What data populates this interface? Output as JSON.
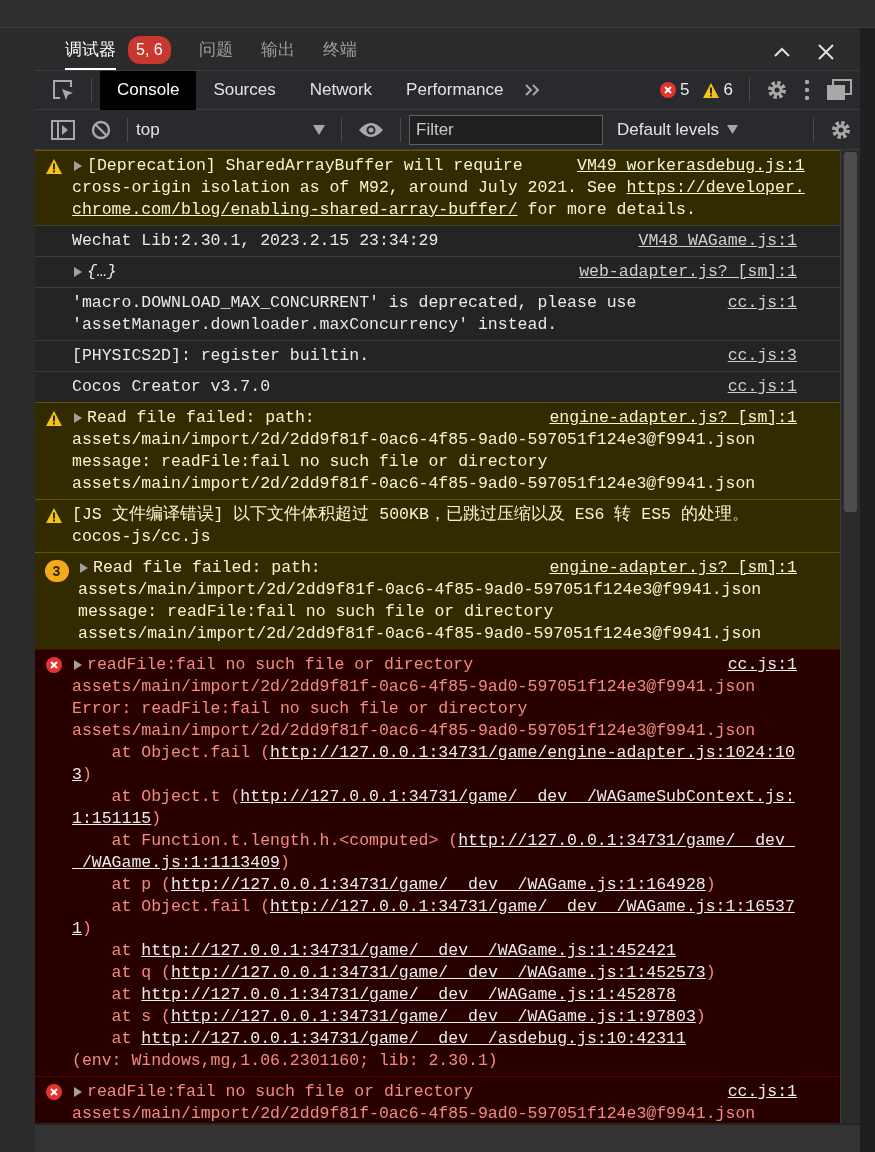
{
  "top_tabs": [
    {
      "label": "调试器",
      "selected": true,
      "badge": "5, 6"
    },
    {
      "label": "问题",
      "selected": false
    },
    {
      "label": "输出",
      "selected": false
    },
    {
      "label": "终端",
      "selected": false
    }
  ],
  "devtools_tabs": [
    {
      "label": "Console",
      "selected": true
    },
    {
      "label": "Sources",
      "selected": false
    },
    {
      "label": "Network",
      "selected": false
    },
    {
      "label": "Performance",
      "selected": false
    }
  ],
  "counts": {
    "errors": "5",
    "warnings": "6"
  },
  "context": {
    "value": "top"
  },
  "filter": {
    "placeholder": "Filter"
  },
  "levels": {
    "label": "Default levels"
  },
  "messages": [
    {
      "kind": "warning",
      "expandable": true,
      "source": "VM49 workerasdebug.js:1",
      "lines": [
        [
          {
            "kind": "text",
            "text": "[Deprecation] SharedArrayBuffer will require"
          }
        ],
        [
          {
            "kind": "text",
            "text": "cross-origin isolation as of M92, around July 2021. See "
          },
          {
            "kind": "link",
            "text": "https://developer."
          }
        ],
        [
          {
            "kind": "link",
            "text": "chrome.com/blog/enabling-shared-array-buffer/"
          },
          {
            "kind": "text",
            "text": " for more details."
          }
        ]
      ]
    },
    {
      "kind": "info",
      "expandable": false,
      "source": "VM48 WAGame.js:1",
      "lines": [
        [
          {
            "kind": "text",
            "text": "Wechat Lib:2.30.1, 2023.2.15 23:34:29"
          }
        ]
      ]
    },
    {
      "kind": "info",
      "expandable": true,
      "source": "web-adapter.js? [sm]:1",
      "lines": [
        [
          {
            "kind": "object",
            "text": "{…}"
          }
        ]
      ]
    },
    {
      "kind": "info",
      "expandable": false,
      "source": "cc.js:1",
      "lines": [
        [
          {
            "kind": "text",
            "text": "'macro.DOWNLOAD_MAX_CONCURRENT' is deprecated, please use"
          }
        ],
        [
          {
            "kind": "text",
            "text": "'assetManager.downloader.maxConcurrency' instead."
          }
        ]
      ]
    },
    {
      "kind": "info",
      "expandable": false,
      "source": "cc.js:3",
      "lines": [
        [
          {
            "kind": "text",
            "text": "[PHYSICS2D]: register builtin."
          }
        ]
      ]
    },
    {
      "kind": "info",
      "expandable": false,
      "source": "cc.js:1",
      "lines": [
        [
          {
            "kind": "text",
            "text": "Cocos Creator v3.7.0"
          }
        ]
      ]
    },
    {
      "kind": "warning",
      "expandable": true,
      "source": "engine-adapter.js? [sm]:1",
      "lines": [
        [
          {
            "kind": "text",
            "text": "Read file failed: path:"
          }
        ],
        [
          {
            "kind": "text",
            "text": "assets/main/import/2d/2dd9f81f-0ac6-4f85-9ad0-597051f124e3@f9941.json"
          }
        ],
        [
          {
            "kind": "text",
            "text": "message: readFile:fail no such file or directory"
          }
        ],
        [
          {
            "kind": "text",
            "text": "assets/main/import/2d/2dd9f81f-0ac6-4f85-9ad0-597051f124e3@f9941.json"
          }
        ]
      ]
    },
    {
      "kind": "warning",
      "expandable": false,
      "lines": [
        [
          {
            "kind": "text",
            "text": "[JS 文件编译错误] 以下文件体积超过 500KB，已跳过压缩以及 ES6 转 ES5 的处理。"
          }
        ],
        [
          {
            "kind": "text",
            "text": "cocos-js/cc.js"
          }
        ]
      ]
    },
    {
      "kind": "warning",
      "expandable": true,
      "repeat_count": "3",
      "source": "engine-adapter.js? [sm]:1",
      "lines": [
        [
          {
            "kind": "text",
            "text": "Read file failed: path:"
          }
        ],
        [
          {
            "kind": "text",
            "text": "assets/main/import/2d/2dd9f81f-0ac6-4f85-9ad0-597051f124e3@f9941.json"
          }
        ],
        [
          {
            "kind": "text",
            "text": "message: readFile:fail no such file or directory"
          }
        ],
        [
          {
            "kind": "text",
            "text": "assets/main/import/2d/2dd9f81f-0ac6-4f85-9ad0-597051f124e3@f9941.json"
          }
        ]
      ]
    },
    {
      "kind": "error",
      "expandable": true,
      "source": "cc.js:1",
      "lines": [
        [
          {
            "kind": "text",
            "text": "readFile:fail no such file or directory"
          }
        ],
        [
          {
            "kind": "text",
            "text": "assets/main/import/2d/2dd9f81f-0ac6-4f85-9ad0-597051f124e3@f9941.json"
          }
        ],
        [
          {
            "kind": "text",
            "text": "Error: readFile:fail no such file or directory"
          }
        ],
        [
          {
            "kind": "text",
            "text": "assets/main/import/2d/2dd9f81f-0ac6-4f85-9ad0-597051f124e3@f9941.json"
          }
        ],
        [
          {
            "kind": "text",
            "text": "    at Object.fail ("
          },
          {
            "kind": "link",
            "text": "http://127.0.0.1:34731/game/engine-adapter.js:1024:10"
          }
        ],
        [
          {
            "kind": "link",
            "text": "3"
          },
          {
            "kind": "text",
            "text": ")"
          }
        ],
        [
          {
            "kind": "text",
            "text": "    at Object.t ("
          },
          {
            "kind": "link",
            "text": "http://127.0.0.1:34731/game/__dev__/WAGameSubContext.js:"
          }
        ],
        [
          {
            "kind": "link",
            "text": "1:151115"
          },
          {
            "kind": "text",
            "text": ")"
          }
        ],
        [
          {
            "kind": "text",
            "text": "    at Function.t.length.h.<computed> ("
          },
          {
            "kind": "link",
            "text": "http://127.0.0.1:34731/game/__dev_"
          }
        ],
        [
          {
            "kind": "link",
            "text": "_/WAGame.js:1:1113409"
          },
          {
            "kind": "text",
            "text": ")"
          }
        ],
        [
          {
            "kind": "text",
            "text": "    at p ("
          },
          {
            "kind": "link",
            "text": "http://127.0.0.1:34731/game/__dev__/WAGame.js:1:164928"
          },
          {
            "kind": "text",
            "text": ")"
          }
        ],
        [
          {
            "kind": "text",
            "text": "    at Object.fail ("
          },
          {
            "kind": "link",
            "text": "http://127.0.0.1:34731/game/__dev__/WAGame.js:1:16537"
          }
        ],
        [
          {
            "kind": "link",
            "text": "1"
          },
          {
            "kind": "text",
            "text": ")"
          }
        ],
        [
          {
            "kind": "text",
            "text": "    at "
          },
          {
            "kind": "link",
            "text": "http://127.0.0.1:34731/game/__dev__/WAGame.js:1:452421"
          }
        ],
        [
          {
            "kind": "text",
            "text": "    at q ("
          },
          {
            "kind": "link",
            "text": "http://127.0.0.1:34731/game/__dev__/WAGame.js:1:452573"
          },
          {
            "kind": "text",
            "text": ")"
          }
        ],
        [
          {
            "kind": "text",
            "text": "    at "
          },
          {
            "kind": "link",
            "text": "http://127.0.0.1:34731/game/__dev__/WAGame.js:1:452878"
          }
        ],
        [
          {
            "kind": "text",
            "text": "    at s ("
          },
          {
            "kind": "link",
            "text": "http://127.0.0.1:34731/game/__dev__/WAGame.js:1:97803"
          },
          {
            "kind": "text",
            "text": ")"
          }
        ],
        [
          {
            "kind": "text",
            "text": "    at "
          },
          {
            "kind": "link",
            "text": "http://127.0.0.1:34731/game/__dev__/asdebug.js:10:42311"
          }
        ],
        [
          {
            "kind": "text",
            "text": "(env: Windows,mg,1.06.2301160; lib: 2.30.1)"
          }
        ]
      ]
    },
    {
      "kind": "error",
      "expandable": true,
      "source": "cc.js:1",
      "lines": [
        [
          {
            "kind": "text",
            "text": "readFile:fail no such file or directory"
          }
        ],
        [
          {
            "kind": "text",
            "text": "assets/main/import/2d/2dd9f81f-0ac6-4f85-9ad0-597051f124e3@f9941.json"
          }
        ]
      ]
    }
  ]
}
